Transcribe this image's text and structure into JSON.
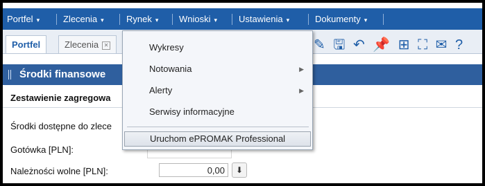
{
  "menubar": {
    "items": [
      {
        "label": "Portfel"
      },
      {
        "label": "Zlecenia"
      },
      {
        "label": "Rynek"
      },
      {
        "label": "Wnioski"
      },
      {
        "label": "Ustawienia"
      },
      {
        "label": "Dokumenty"
      }
    ],
    "caret": "▾"
  },
  "tabs": [
    {
      "label": "Portfel",
      "active": true
    },
    {
      "label": "Zlecenia",
      "close": "✕"
    }
  ],
  "toolbar": {
    "icons": [
      "pencil-icon",
      "save-icon",
      "undo-icon",
      "pin-icon",
      "grid-icon",
      "fullscreen-icon",
      "mail-icon",
      "help-icon"
    ],
    "glyphs": [
      "✎",
      "🖫",
      "↶",
      "📌",
      "⊞",
      "⛶",
      "✉",
      "?"
    ]
  },
  "section": {
    "title": "Środki finansowe"
  },
  "subheader": {
    "label": "Zestawienie zagregowa"
  },
  "rows": [
    {
      "label": "Środki dostępne do zlece"
    },
    {
      "label": "Gotówka [PLN]:"
    },
    {
      "label": "Należności wolne [PLN]:",
      "value": "0,00"
    }
  ],
  "dropdown": {
    "items": [
      {
        "label": "Wykresy",
        "submenu": false
      },
      {
        "label": "Notowania",
        "submenu": true
      },
      {
        "label": "Alerty",
        "submenu": true
      },
      {
        "label": "Serwisy informacyjne",
        "submenu": false
      },
      {
        "label": "Uruchom ePROMAK Professional",
        "submenu": false,
        "highlighted": true
      }
    ],
    "arrow": "▶"
  },
  "colors": {
    "menubar": "#1f5ea8",
    "section": "#2f5f9e",
    "tab_active_text": "#1f5ea8"
  }
}
